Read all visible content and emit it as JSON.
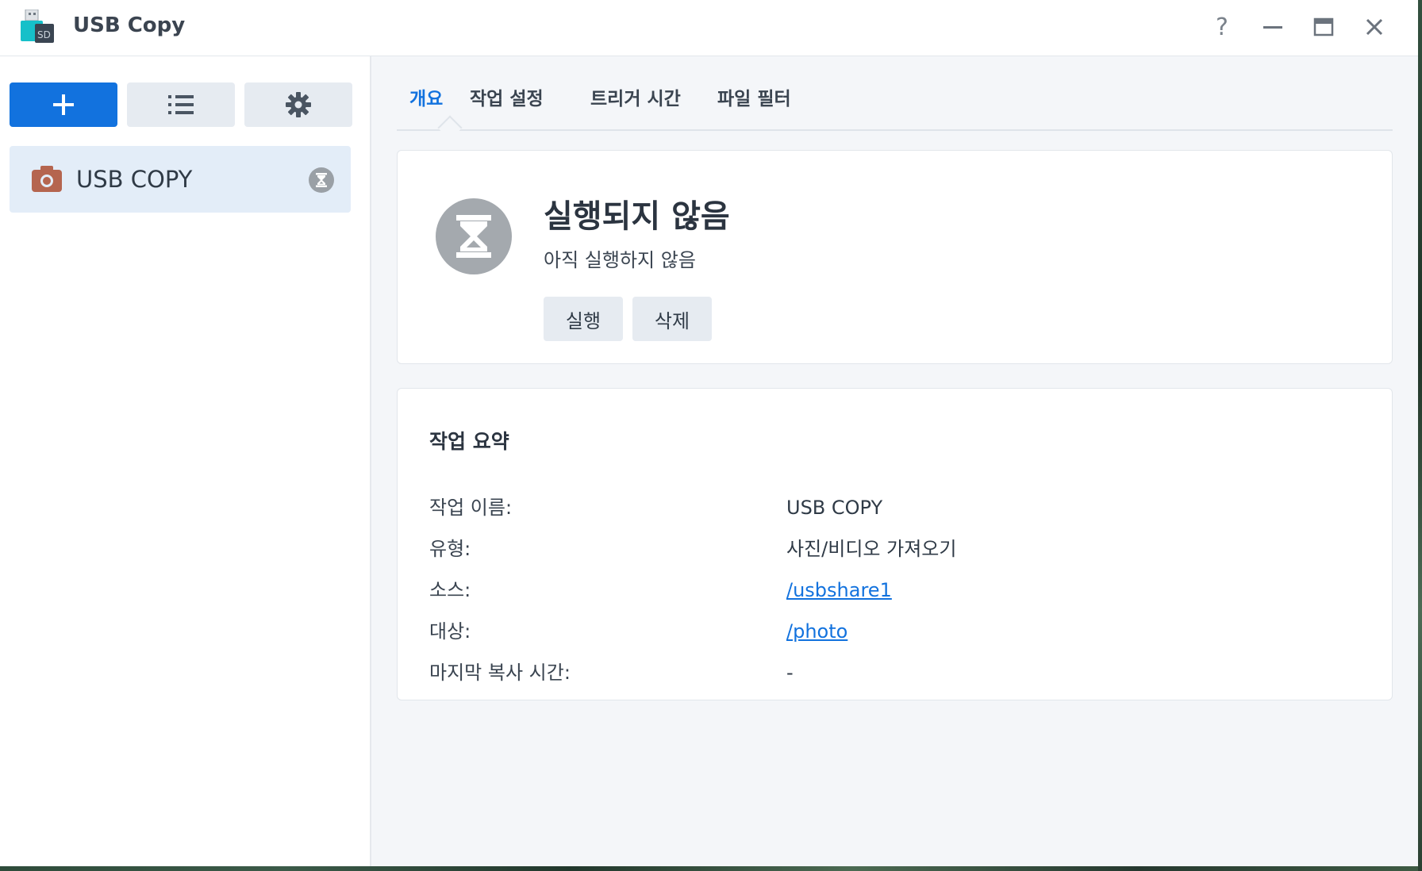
{
  "app": {
    "title": "USB Copy"
  },
  "window_controls": {
    "help": "?"
  },
  "sidebar": {
    "tasks": [
      {
        "label": "USB COPY"
      }
    ]
  },
  "tabs": [
    {
      "label": "개요",
      "active": true
    },
    {
      "label": "작업 설정",
      "active": false
    },
    {
      "label": "트리거 시간",
      "active": false
    },
    {
      "label": "파일 필터",
      "active": false
    }
  ],
  "status": {
    "title": "실행되지 않음",
    "subtitle": "아직 실행하지 않음",
    "run_label": "실행",
    "delete_label": "삭제"
  },
  "summary": {
    "title": "작업 요약",
    "rows": [
      {
        "label": "작업 이름:",
        "value": "USB COPY"
      },
      {
        "label": "유형:",
        "value": "사진/비디오 가져오기"
      },
      {
        "label": "소스:",
        "value": "/usbshare1"
      },
      {
        "label": "대상:",
        "value": "/photo"
      },
      {
        "label": "마지막 복사 시간:",
        "value": "-"
      }
    ]
  },
  "colors": {
    "accent": "#1272de",
    "selected_bg": "#e3edf8",
    "button_gray": "#e6ebf1",
    "status_gray": "#a4a9ae",
    "camera_icon": "#b5654f"
  },
  "icons": {
    "app": "usb-sd-icon",
    "add": "plus-icon",
    "list": "list-icon",
    "settings": "gear-icon",
    "task": "camera-icon",
    "task_status": "hourglass-icon",
    "help": "question-icon",
    "minimize": "minimize-icon",
    "maximize": "maximize-icon",
    "close": "close-icon"
  }
}
